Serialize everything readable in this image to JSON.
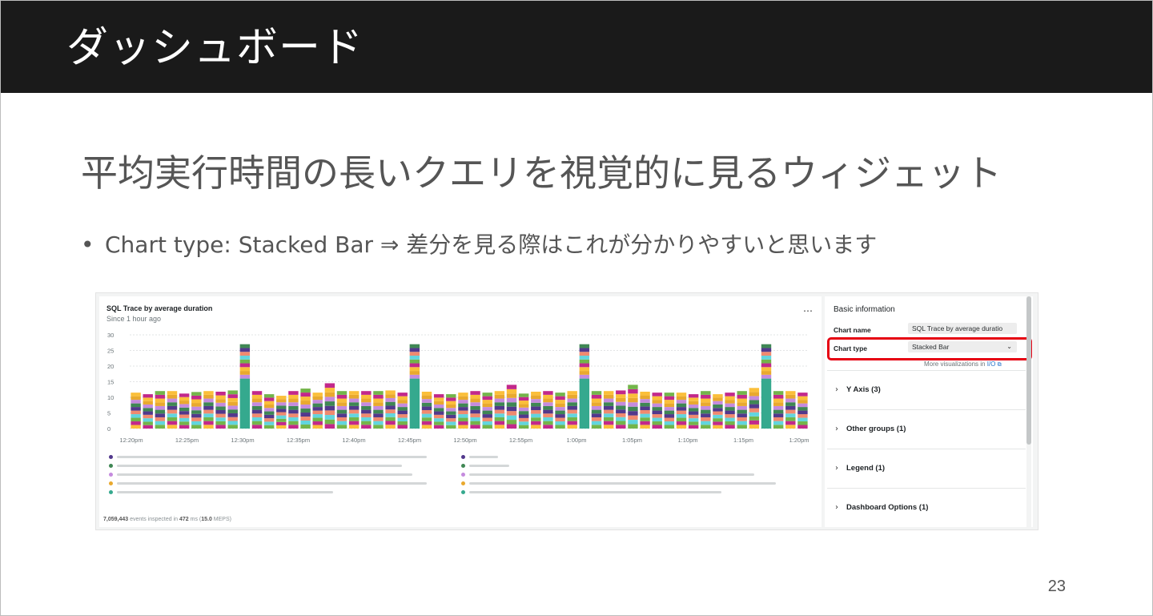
{
  "slide": {
    "title": "ダッシュボード",
    "subtitle": "平均実行時間の長いクエリを視覚的に見るウィジェット",
    "bullet": "Chart type: Stacked Bar  ⇒  差分を見る際はこれが分かりやすいと思います",
    "page_number": "23"
  },
  "widget": {
    "title": "SQL Trace by average duration",
    "since": "Since 1 hour ago",
    "more_icon": "…",
    "footer": {
      "events": "7,059,443",
      "mid1": " events inspected in ",
      "ms": "472",
      "mid2": " ms (",
      "meps": "15.0",
      "end": " MEPS)"
    }
  },
  "panel": {
    "heading": "Basic information",
    "chart_name_label": "Chart name",
    "chart_name_value": "SQL Trace by average duratio",
    "chart_type_label": "Chart type",
    "chart_type_value": "Stacked Bar",
    "more_visualizations": "More visualizations in ",
    "more_visualizations_link": "I/O",
    "sections": [
      "Y Axis (3)",
      "Other groups (1)",
      "Legend (1)",
      "Dashboard Options (1)"
    ]
  },
  "colors": {
    "series": [
      "#fbbf3a",
      "#c2288b",
      "#73b54a",
      "#62d5de",
      "#f08a6f",
      "#52388c",
      "#3f8754",
      "#c58bde",
      "#e9a92e",
      "#35a98e"
    ]
  },
  "chart_data": {
    "type": "bar",
    "stacked": true,
    "title": "SQL Trace by average duration",
    "subtitle": "Since 1 hour ago",
    "ylim": [
      0,
      30
    ],
    "yticks": [
      0,
      5,
      10,
      15,
      20,
      25,
      30
    ],
    "xtick_labels": [
      "12:20pm",
      "12:25pm",
      "12:30pm",
      "12:35pm",
      "12:40pm",
      "12:45pm",
      "12:50pm",
      "12:55pm",
      "1:00pm",
      "1:05pm",
      "1:10pm",
      "1:15pm",
      "1:20pm"
    ],
    "totals": [
      11.5,
      11,
      12,
      12,
      11.2,
      11.7,
      12,
      11.8,
      12.2,
      27,
      12,
      11,
      10.5,
      12,
      12.8,
      11.5,
      14.5,
      12,
      12,
      12,
      12,
      12.2,
      11.5,
      27,
      11.8,
      11,
      11,
      11.5,
      12,
      11.5,
      12,
      14,
      11.2,
      11.8,
      12,
      11.5,
      12,
      27,
      12,
      12,
      12.2,
      14,
      11.8,
      11.5,
      11.5,
      11.5,
      11,
      12,
      11,
      11.5,
      12,
      13,
      27,
      12,
      12,
      11.5
    ],
    "spike_indices": [
      9,
      23,
      37,
      52
    ],
    "spike_base_value": 16,
    "grid": true,
    "legend_entries": 10
  }
}
